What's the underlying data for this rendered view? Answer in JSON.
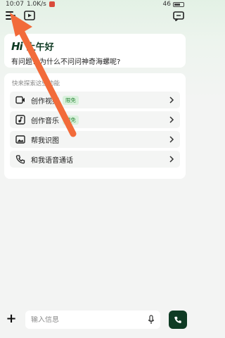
{
  "status_bar": {
    "time": "10:07",
    "speed": "1.0K/s",
    "right_text": "46"
  },
  "greeting": {
    "logo": "Hi",
    "title": "上午好",
    "subtitle": "有问题？为什么不问问神奇海螺呢?"
  },
  "features": {
    "heading": "快来探索这些功能",
    "items": [
      {
        "label": "创作视频",
        "badge": "限免",
        "icon": "video-create-icon"
      },
      {
        "label": "创作音乐",
        "badge": "限免",
        "icon": "music-create-icon"
      },
      {
        "label": "帮我识图",
        "badge": "",
        "icon": "image-recognize-icon"
      },
      {
        "label": "和我语音通话",
        "badge": "",
        "icon": "voice-call-icon"
      }
    ]
  },
  "input": {
    "placeholder": "输入信息"
  },
  "colors": {
    "brand": "#0f3b24",
    "badge_bg": "#d9f1dc",
    "badge_text": "#2f8a3c",
    "arrow": "#f26b3a"
  }
}
